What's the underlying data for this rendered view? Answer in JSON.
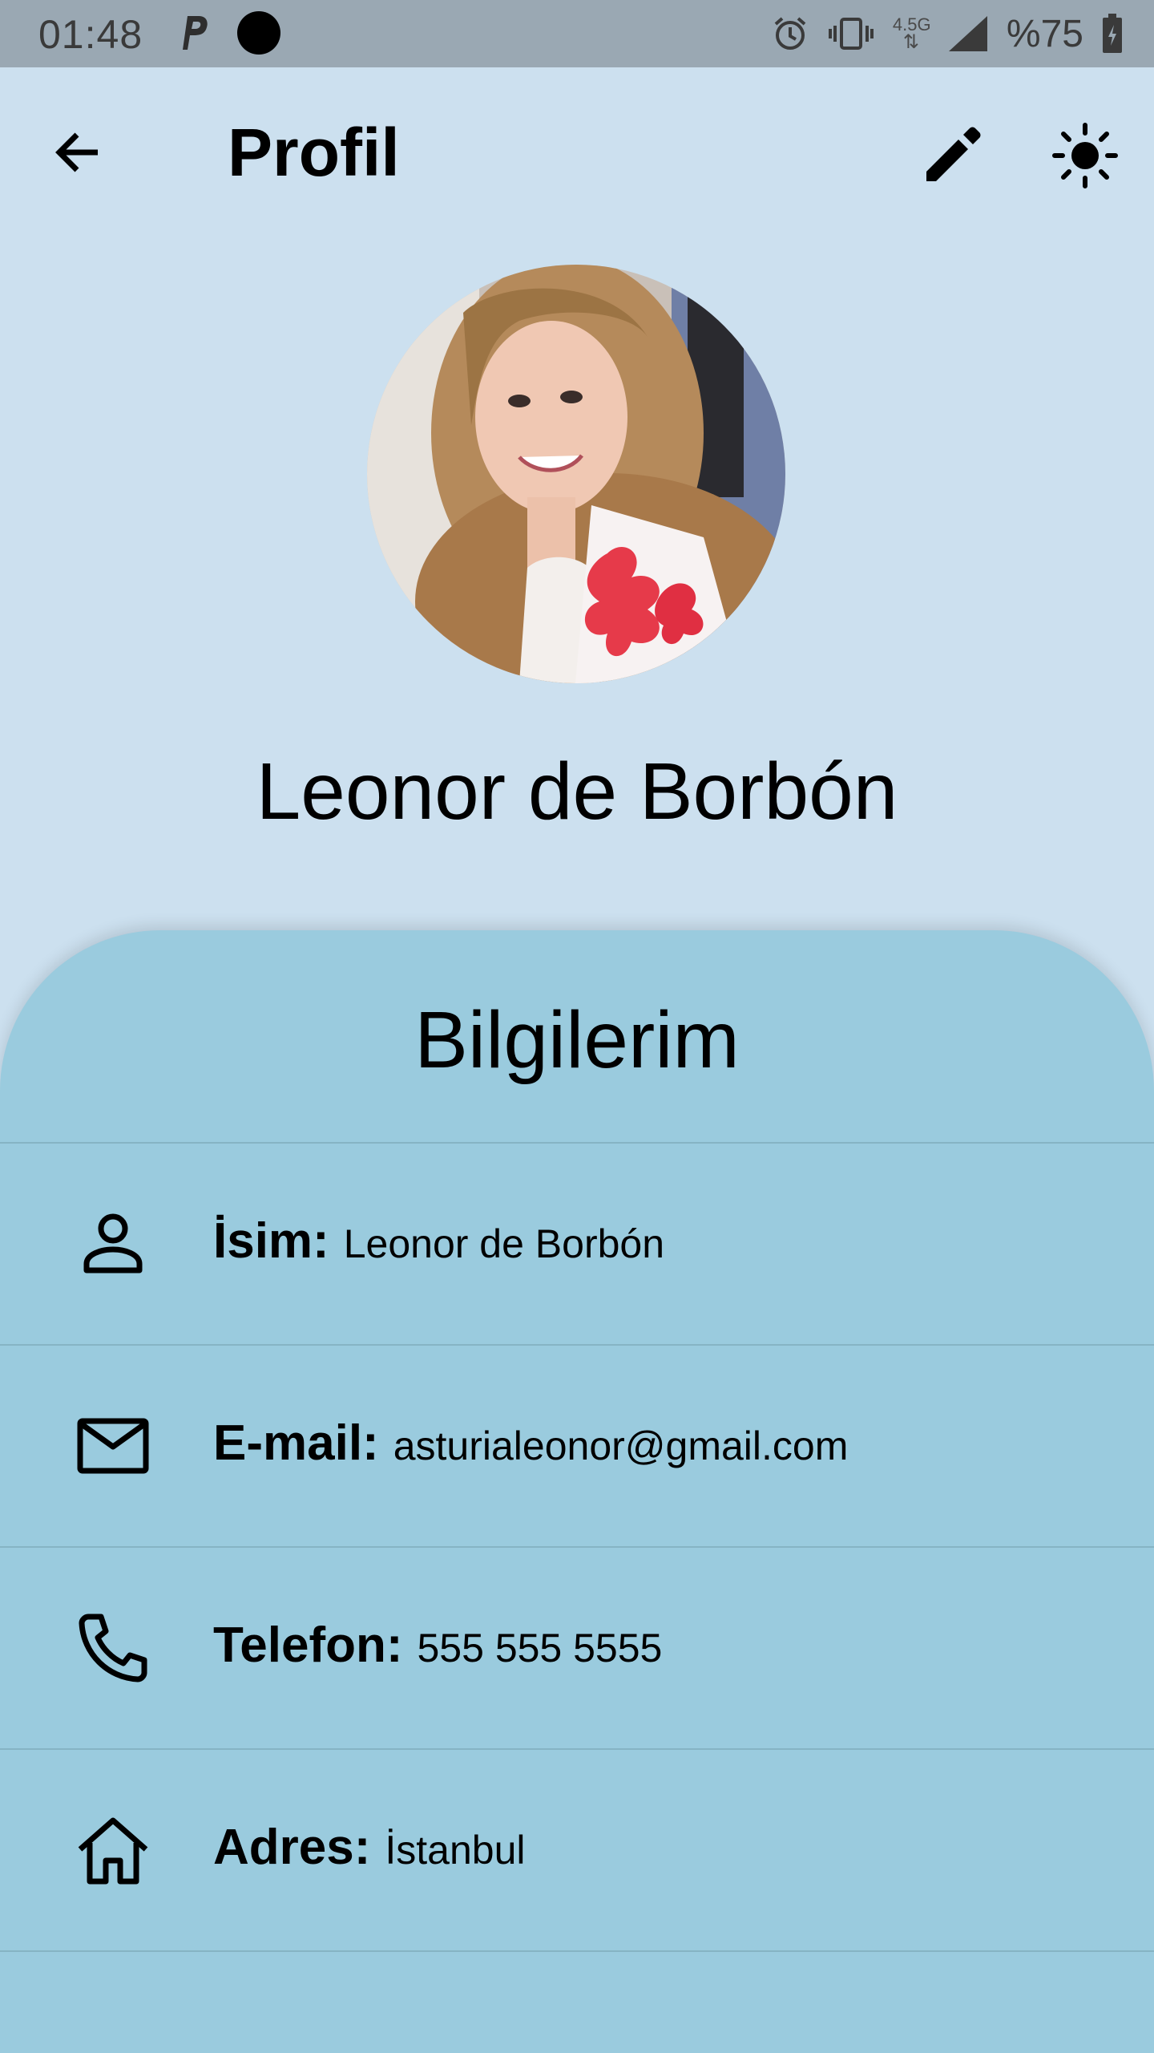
{
  "status_bar": {
    "time": "01:48",
    "network": "4.5G",
    "battery": "%75",
    "icons": [
      "p-app-icon",
      "record-dot-icon",
      "alarm-icon",
      "vibrate-icon",
      "network-arrows-icon",
      "signal-icon",
      "battery-icon"
    ]
  },
  "app_bar": {
    "title": "Profil",
    "icons": [
      "back-arrow-icon",
      "edit-pencil-icon",
      "sun-theme-icon"
    ]
  },
  "profile": {
    "name": "Leonor de Borbón"
  },
  "info": {
    "title": "Bilgilerim",
    "rows": [
      {
        "icon": "person-icon",
        "label": "İsim:",
        "value": "Leonor de Borbón"
      },
      {
        "icon": "mail-icon",
        "label": "E-mail:",
        "value": "asturialeonor@gmail.com"
      },
      {
        "icon": "phone-icon",
        "label": "Telefon:",
        "value": "555 555 5555"
      },
      {
        "icon": "home-icon",
        "label": "Adres:",
        "value": "İstanbul"
      }
    ]
  },
  "colors": {
    "background": "#cce0ef",
    "card": "#9acbde",
    "status_bar": "#9aa8b3"
  }
}
